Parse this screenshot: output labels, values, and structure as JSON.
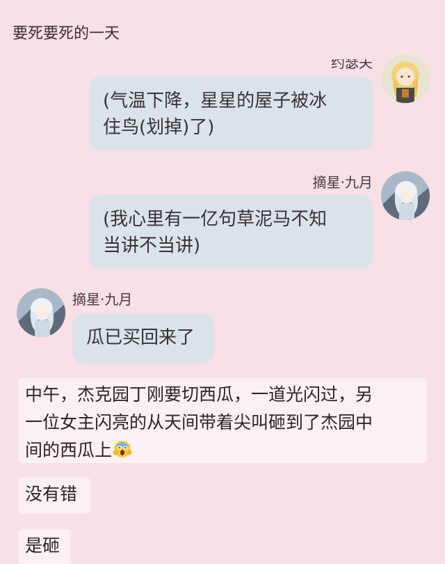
{
  "header": {
    "title": "要死要死的一天"
  },
  "messages": [
    {
      "sender": "约瑟夫",
      "text_line1": "(气温下降，星星的屋子被冰",
      "text_line2": "住鸟(划掉)了)",
      "avatar_icon": "blonde-girl-avatar-icon"
    },
    {
      "sender": "摘星·九月",
      "text_line1": "(我心里有一亿句草泥马不知",
      "text_line2": "当讲不当讲)",
      "avatar_icon": "silver-hair-girl-avatar-icon"
    },
    {
      "sender": "摘星·九月",
      "text": "瓜已买回来了",
      "avatar_icon": "silver-hair-girl-avatar-icon"
    }
  ],
  "narration": [
    {
      "line1": "中午，杰克园丁刚要切西瓜，一道光闪过，另",
      "line2": "一位女主闪亮的从天间带着尖叫砸到了杰园中",
      "line3": "间的西瓜上",
      "emoji": "screaming-face-emoji"
    },
    {
      "text": "没有错"
    },
    {
      "text": "是砸"
    }
  ],
  "colors": {
    "background": "#f8e0e6",
    "bubble": "#dbe3ea",
    "card": "#fbf0f3"
  }
}
